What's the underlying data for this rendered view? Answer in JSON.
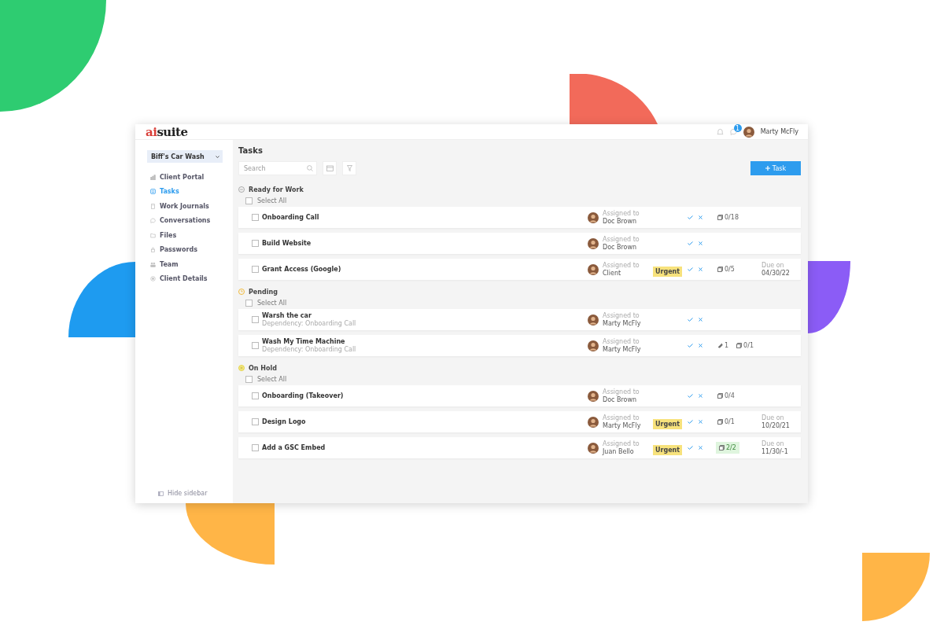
{
  "logo": {
    "prefix": "ai",
    "name": "suite"
  },
  "header": {
    "notification_count": "1",
    "user": "Marty McFly"
  },
  "sidebar": {
    "client": "Biff's Car Wash",
    "items": [
      {
        "label": "Client Portal",
        "selected": false
      },
      {
        "label": "Tasks",
        "selected": true
      },
      {
        "label": "Work Journals",
        "selected": false
      },
      {
        "label": "Conversations",
        "selected": false
      },
      {
        "label": "Files",
        "selected": false
      },
      {
        "label": "Passwords",
        "selected": false
      },
      {
        "label": "Team",
        "selected": false
      },
      {
        "label": "Client Details",
        "selected": false
      }
    ],
    "hide_label": "Hide sidebar"
  },
  "main": {
    "title": "Tasks",
    "search": {
      "placeholder": "Search"
    },
    "add_button": "Task"
  },
  "groups": [
    {
      "name": "Ready for Work",
      "kind": "ready",
      "select_all": {
        "label": "Select All",
        "checked": false
      },
      "tasks": [
        {
          "title": "Onboarding Call",
          "checked": false,
          "assigned_label": "Assigned to",
          "assignee": "Doc Brown",
          "subtasks": {
            "text": "0/18",
            "complete": false
          }
        },
        {
          "title": "Build Website",
          "checked": false,
          "assigned_label": "Assigned to",
          "assignee": "Doc Brown"
        },
        {
          "title": "Grant Access (Google)",
          "checked": false,
          "assigned_label": "Assigned to",
          "assignee": "Client",
          "tag": "Urgent",
          "subtasks": {
            "text": "0/5",
            "complete": false
          },
          "due_label": "Due on",
          "due": "04/30/22"
        }
      ]
    },
    {
      "name": "Pending",
      "kind": "pending",
      "select_all": {
        "label": "Select All",
        "checked": false
      },
      "tasks": [
        {
          "title": "Warsh the car",
          "dependency": "Dependency: Onboarding Call",
          "checked": false,
          "assigned_label": "Assigned to",
          "assignee": "Marty McFly"
        },
        {
          "title": "Wash My Time Machine",
          "dependency": "Dependency: Onboarding Call",
          "checked": false,
          "assigned_label": "Assigned to",
          "assignee": "Marty McFly",
          "attachments": "1",
          "subtasks": {
            "text": "0/1",
            "complete": false
          }
        }
      ]
    },
    {
      "name": "On Hold",
      "kind": "on_hold",
      "select_all": {
        "label": "Select All",
        "checked": false
      },
      "tasks": [
        {
          "title": "Onboarding (Takeover)",
          "checked": false,
          "assigned_label": "Assigned to",
          "assignee": "Doc Brown",
          "subtasks": {
            "text": "0/4",
            "complete": false
          }
        },
        {
          "title": "Design Logo",
          "checked": false,
          "assigned_label": "Assigned to",
          "assignee": "Marty McFly",
          "tag": "Urgent",
          "subtasks": {
            "text": "0/1",
            "complete": false
          },
          "due_label": "Due on",
          "due": "10/20/21"
        },
        {
          "title": "Add a GSC Embed",
          "checked": false,
          "assigned_label": "Assigned to",
          "assignee": "Juan Bello",
          "tag": "Urgent",
          "subtasks": {
            "text": "2/2",
            "complete": true
          },
          "due_label": "Due on",
          "due": "11/30/-1"
        }
      ]
    }
  ]
}
